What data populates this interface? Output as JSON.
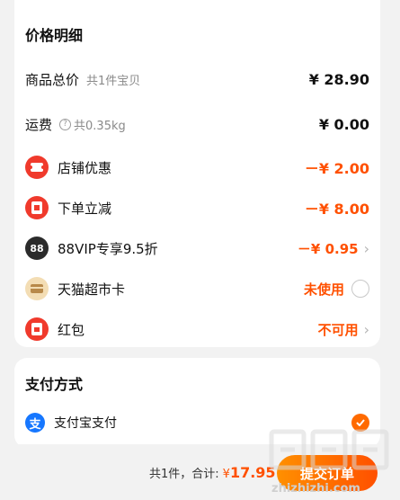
{
  "price_section": {
    "title": "价格明细",
    "goods_total": {
      "label": "商品总价",
      "sub": "共1件宝贝",
      "value": "¥ 28.90"
    },
    "shipping": {
      "label": "运费",
      "help": "?",
      "sub": "共0.35kg",
      "value": "¥ 0.00"
    },
    "shop_discount": {
      "label": "店铺优惠",
      "value": "－¥ 2.00",
      "icon": "coupon-icon"
    },
    "order_discount": {
      "label": "下单立减",
      "value": "－¥ 8.00",
      "icon": "red-envelope-icon"
    },
    "vip_discount": {
      "label": "88VIP专享9.5折",
      "badge": "88",
      "value": "－¥ 0.95",
      "icon": "88vip-icon"
    },
    "tmall_card": {
      "label": "天猫超市卡",
      "value": "未使用",
      "icon": "card-icon"
    },
    "red_packet": {
      "label": "红包",
      "value": "不可用",
      "icon": "red-packet-icon"
    }
  },
  "payment_section": {
    "title": "支付方式",
    "method": {
      "label": "支付宝支付",
      "icon_char": "支",
      "icon": "alipay-icon"
    }
  },
  "bottom_bar": {
    "count_text": "共1件，合计:",
    "currency": "¥",
    "amount": "17.95",
    "submit_label": "提交订单"
  },
  "watermark": {
    "text": "zhizhizhi.com"
  },
  "colors": {
    "accent": "#ff5000",
    "alipay": "#1677ff",
    "red_icon": "#f03a2c"
  }
}
